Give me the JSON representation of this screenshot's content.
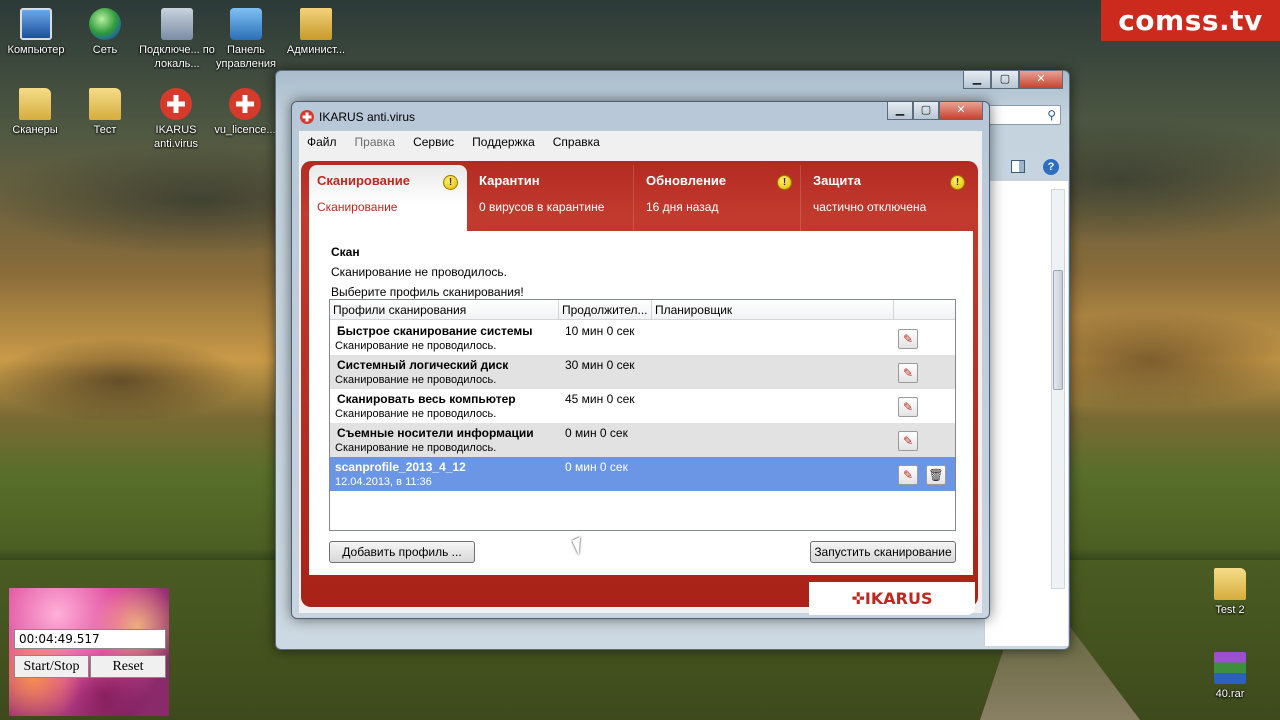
{
  "watermark": "comss.tv",
  "desktop": {
    "icons": [
      {
        "label": "Компьютер",
        "icon": "computer-icon"
      },
      {
        "label": "Сеть",
        "icon": "network-icon"
      },
      {
        "label": "Подключе... по локаль...",
        "icon": "network-connection-icon"
      },
      {
        "label": "Панель управления",
        "icon": "control-panel-icon"
      },
      {
        "label": "Админист...",
        "icon": "admin-folder-icon"
      },
      {
        "label": "Сканеры",
        "icon": "folder-icon"
      },
      {
        "label": "Тест",
        "icon": "folder-icon"
      },
      {
        "label": "IKARUS anti.virus",
        "icon": "ikarus-icon"
      },
      {
        "label": "vu_licence...",
        "icon": "ikarus-icon"
      },
      {
        "label": "Test 2",
        "icon": "folder-icon"
      },
      {
        "label": "40.rar",
        "icon": "rar-archive-icon"
      }
    ]
  },
  "ikarus": {
    "title": "IKARUS anti.virus",
    "menu": [
      "Файл",
      "Правка",
      "Сервис",
      "Поддержка",
      "Справка"
    ],
    "tabs": [
      {
        "title": "Сканирование",
        "subtitle": "Сканирование",
        "warning": true
      },
      {
        "title": "Карантин",
        "subtitle": "0 вирусов в карантине",
        "warning": false
      },
      {
        "title": "Обновление",
        "subtitle": "16 дня назад",
        "warning": true
      },
      {
        "title": "Защита",
        "subtitle": "частично отключена",
        "warning": true
      }
    ],
    "scan": {
      "heading": "Скан",
      "status": "Сканирование не проводилось.",
      "prompt": "Выберите профиль сканирования!"
    },
    "columns": [
      "Профили сканирования",
      "Продолжител...",
      "Планировщик"
    ],
    "profiles": [
      {
        "name": "Быстрое сканирование системы",
        "status": "Сканирование не проводилось.",
        "duration": "10 мин 0 сек"
      },
      {
        "name": "Системный логический диск",
        "status": "Сканирование не проводилось.",
        "duration": "30 мин 0 сек"
      },
      {
        "name": "Сканировать весь компьютер",
        "status": "Сканирование не проводилось.",
        "duration": "45 мин 0 сек"
      },
      {
        "name": "Съемные носители информации",
        "status": "Сканирование не проводилось.",
        "duration": "0 мин 0 сек"
      },
      {
        "name": "scanprofile_2013_4_12",
        "status": "12.04.2013, в 11:36",
        "duration": "0 мин 0 сек"
      }
    ],
    "add_profile_label": "Добавить профиль ...",
    "start_scan_label": "Запустить сканирование",
    "brand": "✜IKARUS"
  },
  "stopwatch": {
    "time": "00:04:49.517",
    "start_stop_label": "Start/Stop",
    "reset_label": "Reset"
  },
  "colors": {
    "ikarus_red": "#c0281e",
    "selection_blue": "#6b96e6",
    "watermark_red": "#cc2a1c"
  }
}
